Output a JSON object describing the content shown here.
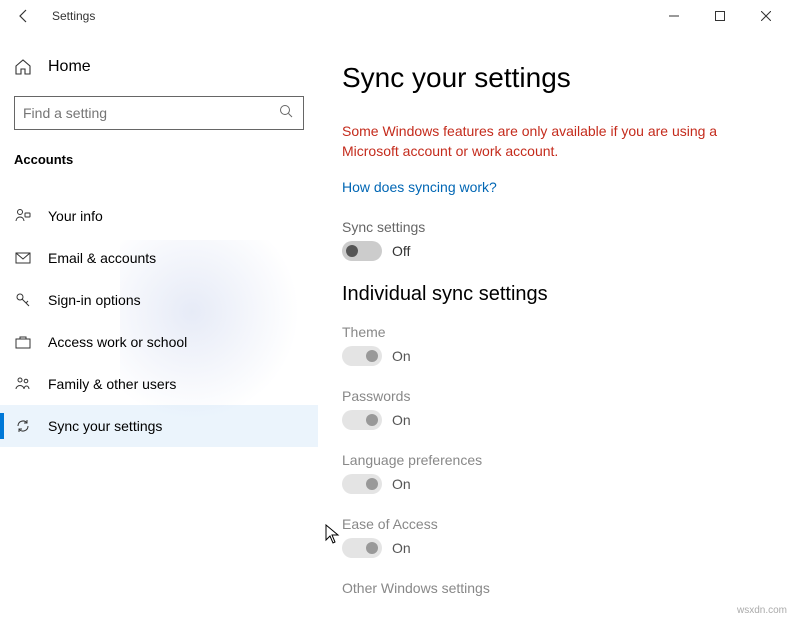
{
  "app": {
    "title": "Settings"
  },
  "sidebar": {
    "home": "Home",
    "search_placeholder": "Find a setting",
    "category": "Accounts",
    "items": [
      {
        "label": "Your info"
      },
      {
        "label": "Email & accounts"
      },
      {
        "label": "Sign-in options"
      },
      {
        "label": "Access work or school"
      },
      {
        "label": "Family & other users"
      },
      {
        "label": "Sync your settings"
      }
    ]
  },
  "main": {
    "title": "Sync your settings",
    "warning": "Some Windows features are only available if you are using a Microsoft account or work account.",
    "link": "How does syncing work?",
    "sync_label": "Sync settings",
    "off": "Off",
    "on": "On",
    "section": "Individual sync settings",
    "settings": [
      {
        "label": "Theme"
      },
      {
        "label": "Passwords"
      },
      {
        "label": "Language preferences"
      },
      {
        "label": "Ease of Access"
      },
      {
        "label": "Other Windows settings"
      }
    ]
  },
  "footer": "wsxdn.com"
}
